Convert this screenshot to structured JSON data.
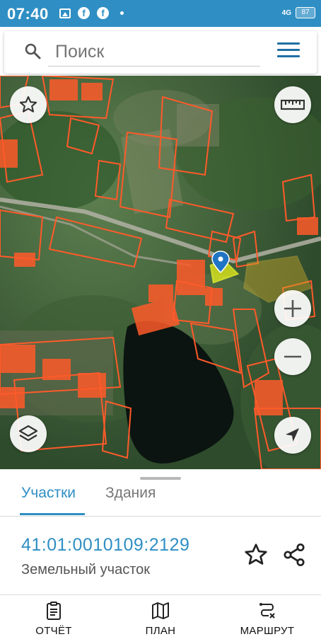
{
  "status_bar": {
    "time": "07:40",
    "signal": "4G",
    "battery": "87",
    "icons": [
      "gallery-icon",
      "facebook-icon",
      "facebook-icon",
      "dot-icon"
    ]
  },
  "search": {
    "placeholder": "Поиск"
  },
  "map": {
    "buttons": [
      "star-icon",
      "ruler-icon",
      "zoom-in-icon",
      "zoom-out-icon",
      "layers-icon",
      "locate-icon"
    ],
    "colors": {
      "parcel_outline": "#ff5a2a",
      "selected_parcel": "#e8f01a",
      "marker": "#1f74c4",
      "lake": "#0b1410"
    }
  },
  "tabs": [
    {
      "label": "Участки",
      "active": true
    },
    {
      "label": "Здания",
      "active": false
    }
  ],
  "parcel": {
    "number": "41:01:0010109:2129",
    "type": "Земельный участок"
  },
  "bottom_nav": [
    {
      "label": "ОТЧЁТ",
      "icon": "report-icon"
    },
    {
      "label": "ПЛАН",
      "icon": "map-plan-icon"
    },
    {
      "label": "МАРШРУТ",
      "icon": "route-icon"
    }
  ],
  "colors": {
    "accent": "#2f8fc4",
    "statusbar": "#2f8fc4"
  }
}
